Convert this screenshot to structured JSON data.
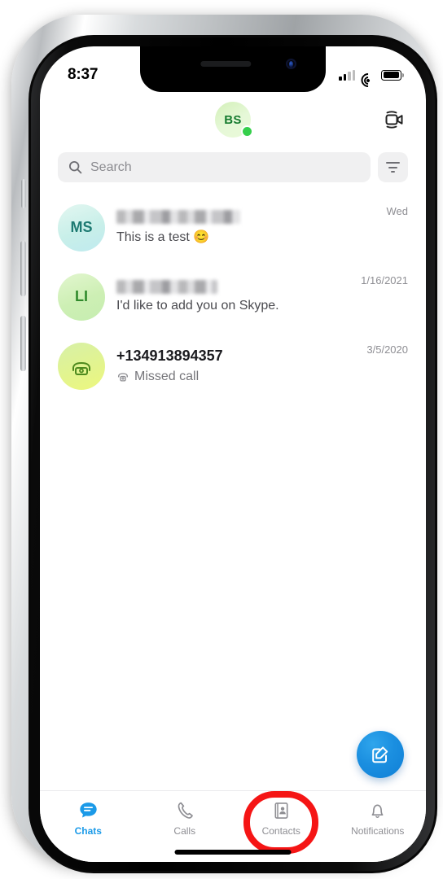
{
  "device": {
    "frame": "iphone-x-silver"
  },
  "status_bar": {
    "time": "8:37",
    "signal_icon": "cellular-signal-icon",
    "signal_bars_filled": 2,
    "signal_bars_total": 4,
    "wifi_icon": "wifi-icon",
    "battery_icon": "battery-icon"
  },
  "header": {
    "avatar_initials": "BS",
    "presence": "online",
    "presence_color": "#35cf4b",
    "meet_now_icon": "video-camera-icon"
  },
  "search": {
    "icon": "search-icon",
    "placeholder": "Search",
    "value": "",
    "filter_icon": "filter-icon"
  },
  "chats": [
    {
      "avatar_initials": "MS",
      "avatar_type": "initials",
      "name_redacted": true,
      "name": "",
      "preview": "This is a test 😊",
      "time": "Wed"
    },
    {
      "avatar_initials": "LI",
      "avatar_type": "initials",
      "name_redacted": true,
      "name": "",
      "preview": "I'd like to add you on Skype.",
      "time": "1/16/2021"
    },
    {
      "avatar_initials": "",
      "avatar_type": "phone-icon",
      "name_redacted": false,
      "name": "+134913894357",
      "preview": "Missed call",
      "preview_icon": "missed-call-phone-icon",
      "time": "3/5/2020"
    }
  ],
  "fab": {
    "icon": "compose-icon",
    "color": "#1b8fe0"
  },
  "tabbar": {
    "active": "Chats",
    "active_color": "#1b9ae8",
    "highlight": {
      "target": "Contacts",
      "shape": "rounded-rectangle",
      "color": "#f51515"
    },
    "items": [
      {
        "label": "Chats",
        "icon": "chat-bubble-icon"
      },
      {
        "label": "Calls",
        "icon": "phone-handset-icon"
      },
      {
        "label": "Contacts",
        "icon": "contact-book-icon"
      },
      {
        "label": "Notifications",
        "icon": "bell-icon"
      }
    ]
  }
}
